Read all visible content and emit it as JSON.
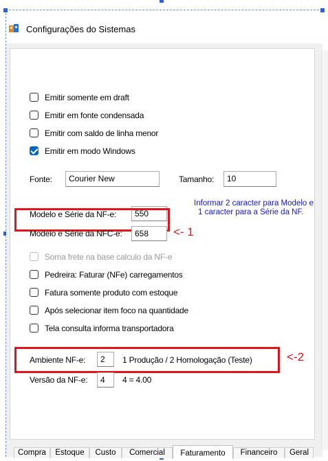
{
  "window": {
    "title": "Configurações do Sistemas"
  },
  "options_top": [
    {
      "label": "Emitir somente em draft",
      "checked": false
    },
    {
      "label": "Emitir em fonte condensada",
      "checked": false
    },
    {
      "label": "Emitir com saldo de linha menor",
      "checked": false
    },
    {
      "label": "Emitir em modo Windows",
      "checked": true
    }
  ],
  "font": {
    "label": "Fonte:",
    "value": "Courier New",
    "size_label": "Tamanho:",
    "size_value": "10"
  },
  "nfe_model": {
    "label": "Modelo e Série da NF-e:",
    "value": "550"
  },
  "nfce_model": {
    "label": "Modelo e Série da NFC-e:",
    "value": "658"
  },
  "annotations": {
    "arrow1": "<- 1",
    "arrow2": "<-2",
    "note_line1": "Informar 2 caracter para Modelo e",
    "note_line2": "1 caracter para a Série da NF."
  },
  "options_bottom": [
    {
      "label": "Soma frete na base calculo da NF-e",
      "checked": false,
      "disabled": true
    },
    {
      "label": "Pedreira: Faturar (NFe) carregamentos",
      "checked": false,
      "disabled": false
    },
    {
      "label": "Fatura somente produto com estoque",
      "checked": false,
      "disabled": false
    },
    {
      "label": "Após selecionar item foco na quantidade",
      "checked": false,
      "disabled": false
    },
    {
      "label": "Tela consulta informa transportadora",
      "checked": false,
      "disabled": false
    }
  ],
  "ambiente": {
    "label": "Ambiente NF-e:",
    "value": "2",
    "hint": "1 Produção / 2 Homologação (Teste)"
  },
  "versao": {
    "label": "Versão da NF-e:",
    "value": "4",
    "hint": "4 = 4.00"
  },
  "tabs": [
    "Compra",
    "Estoque",
    "Custo",
    "Comercial",
    "Faturamento",
    "Financeiro",
    "Geral"
  ],
  "active_tab": "Faturamento",
  "colors": {
    "checkbox_checked": "#0067c0",
    "annotation_red": "#e0151b",
    "note_blue": "#1414e6",
    "selection": "#2a62d6"
  }
}
